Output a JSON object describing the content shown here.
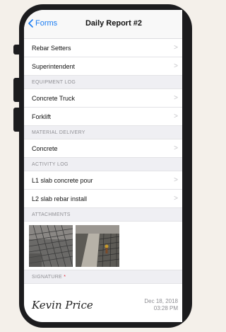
{
  "nav": {
    "back_label": "Forms",
    "title": "Daily Report #2"
  },
  "rows_top": [
    {
      "label": "Rebar Setters"
    },
    {
      "label": "Superintendent"
    }
  ],
  "sections": {
    "equipment": "EQUIPMENT LOG",
    "material": "MATERIAL DELIVERY",
    "activity": "ACTIVITY LOG",
    "attachments": "ATTACHMENTS",
    "signature": "SIGNATURE",
    "signature_required": "*"
  },
  "equipment_items": [
    {
      "label": "Concrete Truck"
    },
    {
      "label": "Forklift"
    }
  ],
  "material_items": [
    {
      "label": "Concrete"
    }
  ],
  "activity_items": [
    {
      "label": "L1 slab concrete pour"
    },
    {
      "label": "L2 slab rebar install"
    }
  ],
  "signature": {
    "name": "Kevin Price",
    "date": "Dec 18, 2018",
    "time": "03:28 PM"
  },
  "colors": {
    "accent": "#1a7cf2",
    "required": "#e0283a"
  }
}
